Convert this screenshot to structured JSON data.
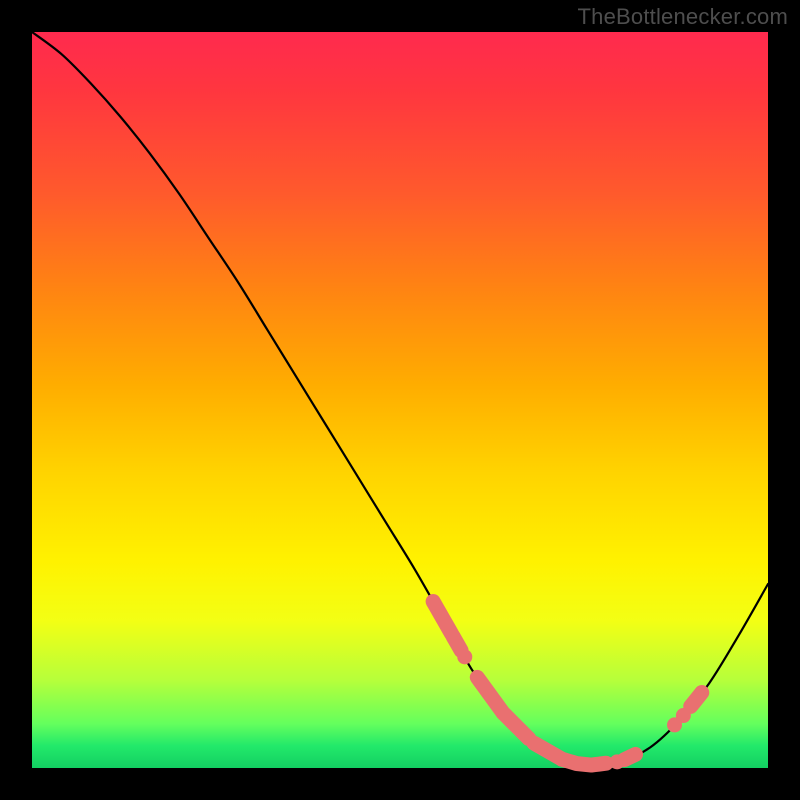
{
  "watermark": {
    "text": "TheBottlenecker.com"
  },
  "chart_data": {
    "type": "line",
    "title": "",
    "xlabel": "",
    "ylabel": "",
    "xlim": [
      0,
      100
    ],
    "ylim": [
      0,
      100
    ],
    "background_gradient": {
      "top": "#ff2a4e",
      "bottom": "#13cf62",
      "meaning": "red = high bottleneck, green = low bottleneck"
    },
    "series": [
      {
        "name": "bottleneck-curve",
        "x": [
          0,
          4,
          8,
          12,
          16,
          20,
          24,
          28,
          32,
          36,
          40,
          44,
          48,
          52,
          56,
          58,
          60,
          64,
          68,
          72,
          74,
          76,
          80,
          84,
          88,
          92,
          96,
          100
        ],
        "y": [
          100,
          97,
          93,
          88.5,
          83.5,
          78,
          72,
          66,
          59.5,
          53,
          46.5,
          40,
          33.5,
          27,
          20,
          16.5,
          13,
          7.5,
          3.5,
          1.2,
          0.6,
          0.4,
          0.9,
          2.8,
          6.5,
          11.5,
          18,
          25
        ],
        "color": "#000000"
      }
    ],
    "markers": {
      "meaning": "highlighted data points / segments on the curve",
      "color": "#e97070",
      "points": [
        {
          "x_start": 54.5,
          "x_end": 57.0,
          "shape": "pill"
        },
        {
          "x_start": 57.2,
          "x_end": 58.3,
          "shape": "pill"
        },
        {
          "x": 58.8,
          "shape": "dot"
        },
        {
          "x_start": 60.5,
          "x_end": 64.5,
          "shape": "pill"
        },
        {
          "x_start": 64.7,
          "x_end": 67.5,
          "shape": "pill"
        },
        {
          "x_start": 68.2,
          "x_end": 72.0,
          "shape": "pill"
        },
        {
          "x_start": 72.0,
          "x_end": 78.0,
          "shape": "pill"
        },
        {
          "x": 79.5,
          "shape": "dot"
        },
        {
          "x_start": 80.5,
          "x_end": 82.0,
          "shape": "pill"
        },
        {
          "x": 87.3,
          "shape": "dot"
        },
        {
          "x": 88.5,
          "shape": "dot"
        },
        {
          "x_start": 89.5,
          "x_end": 91.0,
          "shape": "pill"
        }
      ]
    }
  }
}
